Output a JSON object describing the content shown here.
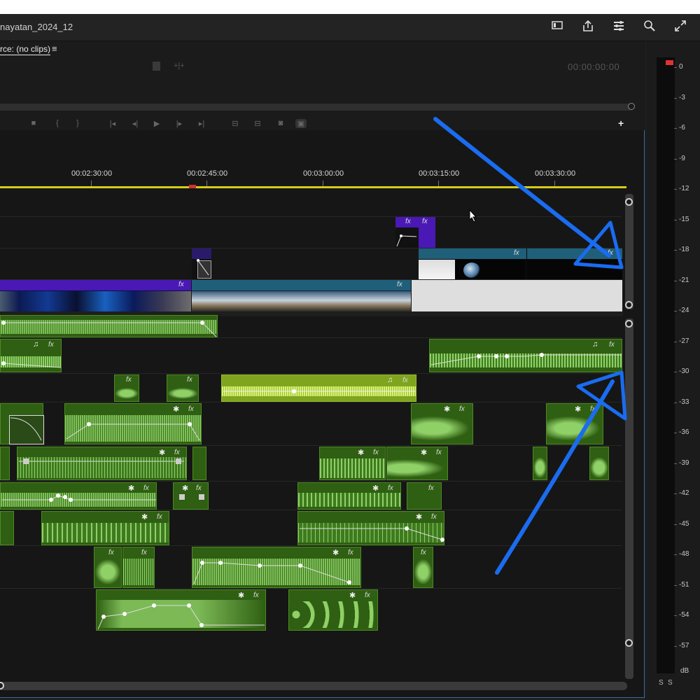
{
  "header": {
    "sequence_title": "nayatan_2024_12",
    "icons": [
      "panel-icon",
      "share-icon",
      "settings-icon",
      "zoom-icon",
      "fullscreen-icon"
    ]
  },
  "source_monitor": {
    "tab_label": "rce: (no clips)",
    "menu_glyph": "≡",
    "timecode": "00:00:00:00"
  },
  "timeline": {
    "ruler_labels": [
      "00:02:30:00",
      "00:02:45:00",
      "00:03:00:00",
      "00:03:15:00",
      "00:03:30:00"
    ],
    "fx_label": "fx",
    "music_glyph": "♫",
    "star_glyph": "✱",
    "colors": {
      "ruler": "#d4cc1b",
      "video_clip_purple": "#4a18b4",
      "video_clip_teal": "#1f5f7a",
      "audio_clip": "#2f5f12",
      "audio_clip_yellow": "#7fa41e",
      "annotation_arrow": "#1a6cf0"
    }
  },
  "meter": {
    "db_labels": [
      "0",
      "-3",
      "-6",
      "-9",
      "-12",
      "-15",
      "-18",
      "-21",
      "-24",
      "-27",
      "-30",
      "-33",
      "-36",
      "-39",
      "-42",
      "-45",
      "-48",
      "-51",
      "-54",
      "-57",
      "dB"
    ],
    "solo_labels": [
      "S",
      "S"
    ]
  }
}
